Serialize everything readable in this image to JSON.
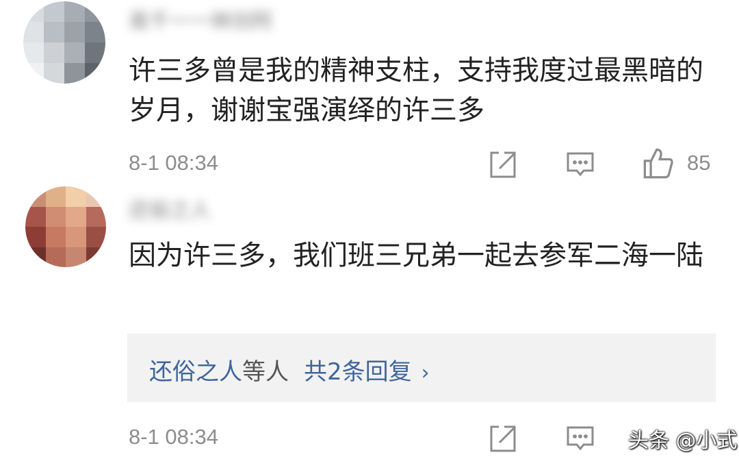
{
  "comments": [
    {
      "username": "易千一一林剑阿",
      "content": "许三多曾是我的精神支柱，支持我度过最黑暗的岁月，谢谢宝强演绎的许三多",
      "time": "8-1 08:34",
      "likes": "85"
    },
    {
      "username": "还俗之人",
      "content": "因为许三多，我们班三兄弟一起去参军二海一陆",
      "time": "8-1 08:34"
    }
  ],
  "replies": {
    "names": "还俗之人",
    "others": "等人",
    "count": "共2条回复",
    "chevron": "›"
  },
  "watermark": "头条 @小式",
  "icons": {
    "share": "share-icon",
    "comment": "comment-icon",
    "like": "thumbs-up-icon"
  },
  "colors": {
    "reply_link": "#406599",
    "meta_text": "#8c8c8c",
    "reply_bg": "#f2f2f2"
  }
}
